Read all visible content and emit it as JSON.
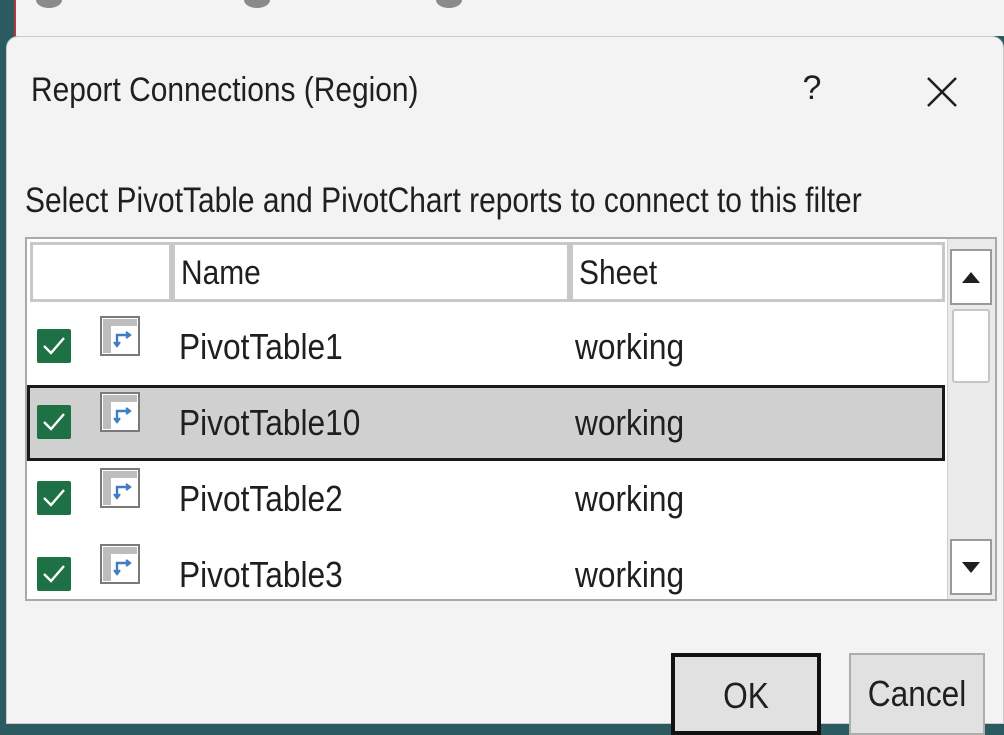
{
  "dialog": {
    "title": "Report Connections (Region)",
    "help_label": "?",
    "instruction": "Select PivotTable and PivotChart reports to connect to this filter"
  },
  "table": {
    "headers": {
      "name": "Name",
      "sheet": "Sheet"
    },
    "rows": [
      {
        "name": "PivotTable1",
        "sheet": "working",
        "checked": true,
        "selected": false
      },
      {
        "name": "PivotTable10",
        "sheet": "working",
        "checked": true,
        "selected": true
      },
      {
        "name": "PivotTable2",
        "sheet": "working",
        "checked": true,
        "selected": false
      },
      {
        "name": "PivotTable3",
        "sheet": "working",
        "checked": true,
        "selected": false
      }
    ]
  },
  "buttons": {
    "ok": "OK",
    "cancel": "Cancel"
  },
  "icons": {
    "close": "close-icon",
    "checkbox": "checkmark-icon",
    "pivot": "pivot-table-icon",
    "scroll_up": "arrow-up-icon",
    "scroll_down": "arrow-down-icon"
  },
  "colors": {
    "checkbox_fill": "#1e7145",
    "selected_row": "#d0d0d0",
    "dialog_bg": "#f3f3f3"
  }
}
